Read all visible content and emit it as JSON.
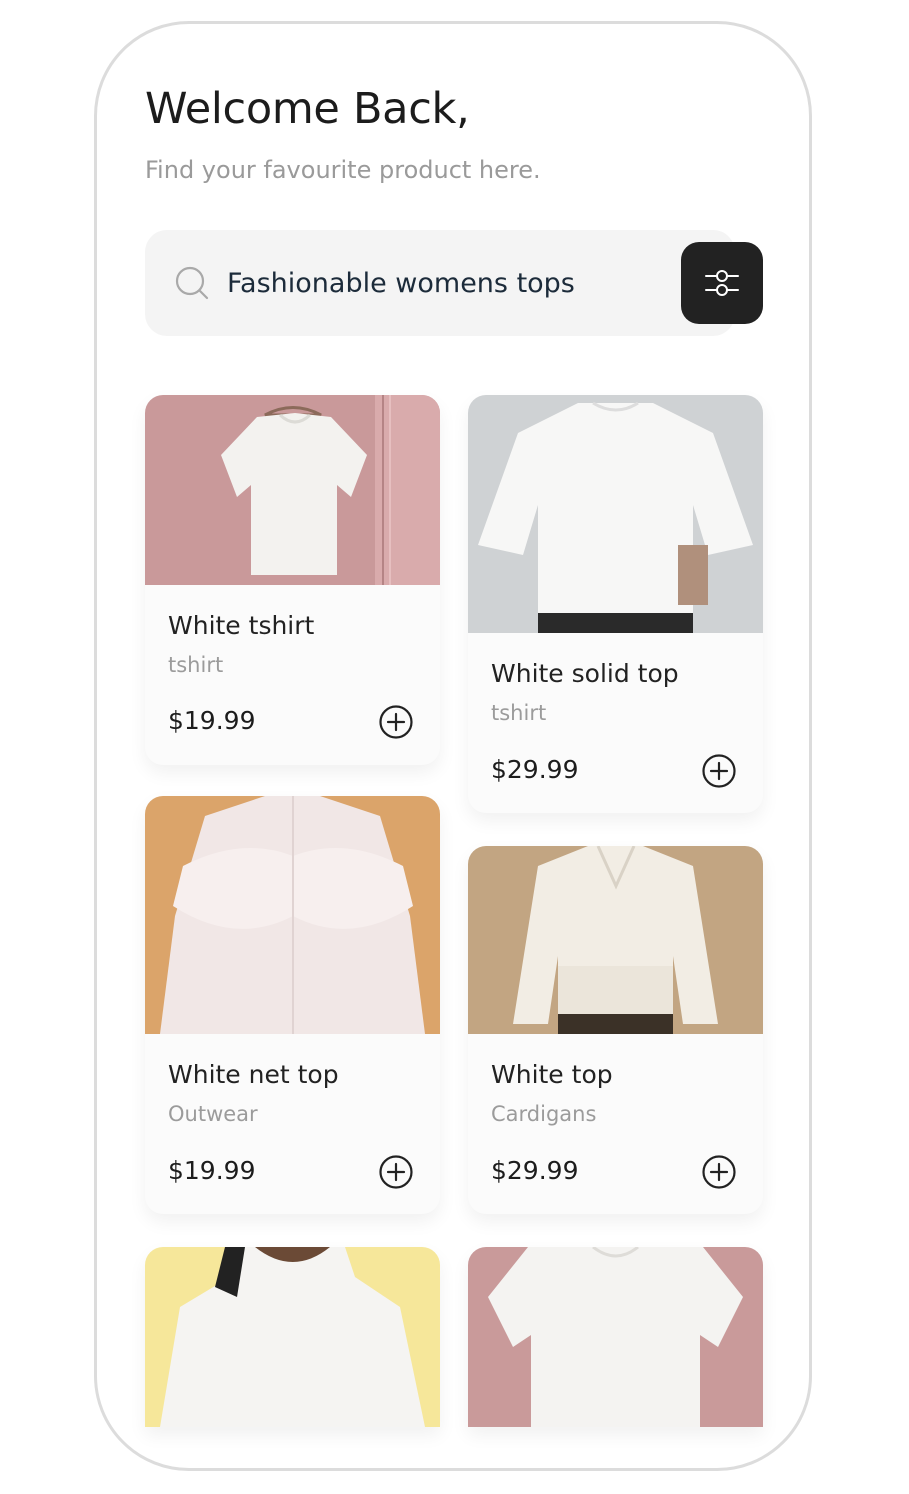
{
  "header": {
    "title": "Welcome Back,",
    "subtitle": "Find your favourite product here."
  },
  "search": {
    "value": "Fashionable womens tops",
    "icon": "search-icon"
  },
  "filter": {
    "icon": "sliders-icon",
    "bg": "#222222"
  },
  "products": [
    {
      "name": "White tshirt",
      "category": "tshirt",
      "price": "$19.99"
    },
    {
      "name": "White solid top",
      "category": "tshirt",
      "price": "$29.99"
    },
    {
      "name": "White net top",
      "category": "Outwear",
      "price": "$19.99"
    },
    {
      "name": "White top",
      "category": "Cardigans",
      "price": "$29.99"
    }
  ],
  "colors": {
    "title": "#1c1c1c",
    "muted": "#9a9a9a",
    "accent": "#222222"
  }
}
